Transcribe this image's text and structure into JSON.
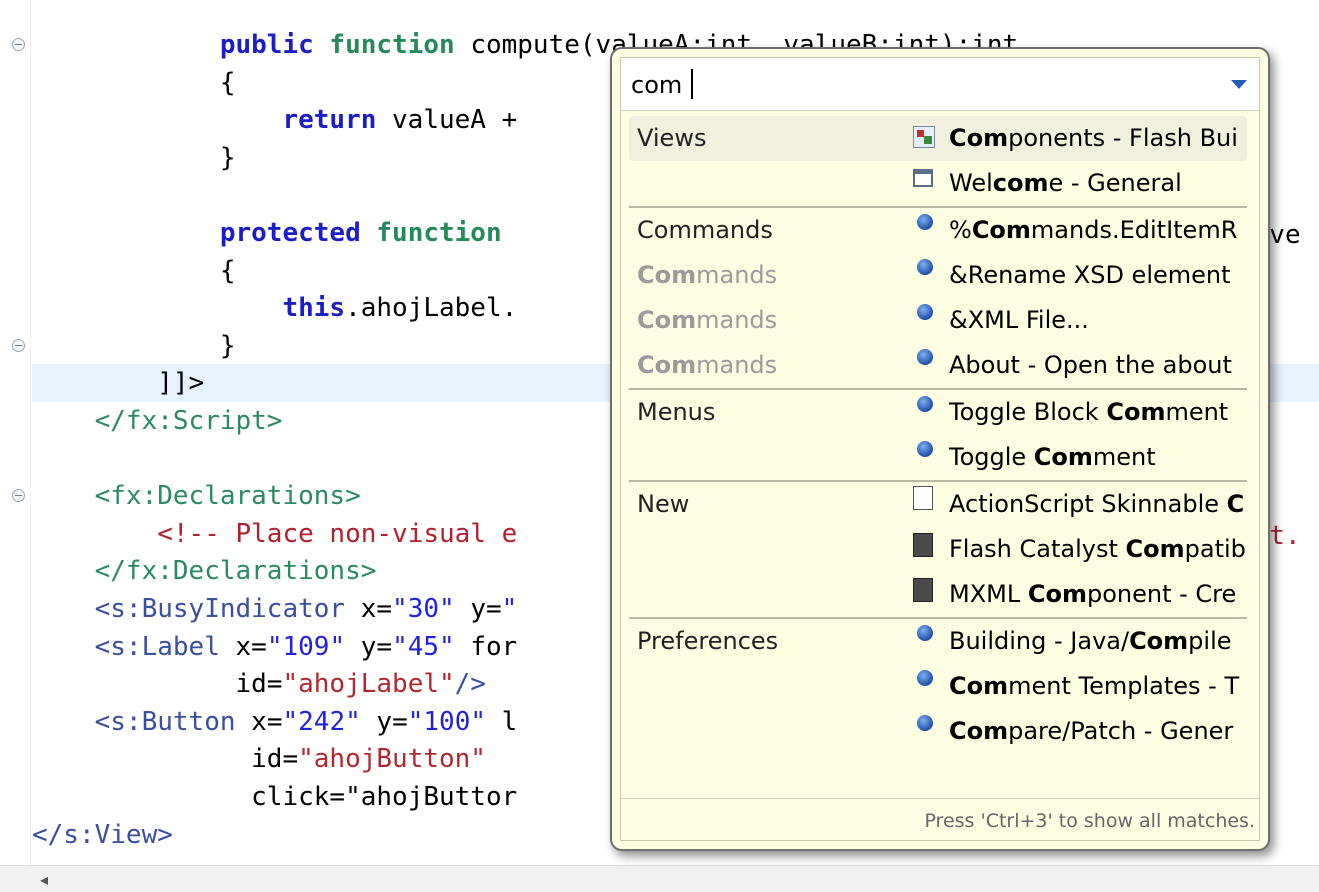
{
  "editor": {
    "lines": [
      {
        "parts": [
          {
            "c": "",
            "t": "            "
          },
          {
            "c": "kw",
            "t": "public "
          },
          {
            "c": "kwg",
            "t": "function "
          },
          {
            "c": "",
            "t": "compute(valueA:int, valueB:int):int"
          }
        ]
      },
      {
        "parts": [
          {
            "c": "",
            "t": "            {"
          }
        ]
      },
      {
        "parts": [
          {
            "c": "",
            "t": "                "
          },
          {
            "c": "kw",
            "t": "return "
          },
          {
            "c": "",
            "t": "valueA + "
          }
        ]
      },
      {
        "parts": [
          {
            "c": "",
            "t": "            }"
          }
        ]
      },
      {
        "parts": [
          {
            "c": "",
            "t": ""
          }
        ]
      },
      {
        "parts": [
          {
            "c": "",
            "t": "            "
          },
          {
            "c": "kw",
            "t": "protected "
          },
          {
            "c": "kwg",
            "t": "function "
          }
        ]
      },
      {
        "parts": [
          {
            "c": "",
            "t": "            {"
          }
        ]
      },
      {
        "parts": [
          {
            "c": "",
            "t": "                "
          },
          {
            "c": "kw",
            "t": "this"
          },
          {
            "c": "",
            "t": ".ahojLabel."
          }
        ]
      },
      {
        "parts": [
          {
            "c": "",
            "t": "            }"
          }
        ]
      },
      {
        "parts": [
          {
            "c": "",
            "t": "        ]]>"
          }
        ],
        "highlight": true
      },
      {
        "parts": [
          {
            "c": "",
            "t": "    "
          },
          {
            "c": "tag",
            "t": "</fx:Script>"
          }
        ]
      },
      {
        "parts": [
          {
            "c": "",
            "t": ""
          }
        ]
      },
      {
        "parts": [
          {
            "c": "",
            "t": "    "
          },
          {
            "c": "tag",
            "t": "<fx:Declarations>"
          }
        ]
      },
      {
        "parts": [
          {
            "c": "",
            "t": "        "
          },
          {
            "c": "comment",
            "t": "<!-- Place non-visual e"
          }
        ]
      },
      {
        "parts": [
          {
            "c": "",
            "t": "    "
          },
          {
            "c": "tag",
            "t": "</fx:Declarations>"
          }
        ]
      },
      {
        "parts": [
          {
            "c": "",
            "t": "    "
          },
          {
            "c": "tagb",
            "t": "<s:BusyIndicator"
          },
          {
            "c": "attr",
            "t": " x="
          },
          {
            "c": "val",
            "t": "\"30\""
          },
          {
            "c": "attr",
            "t": " y="
          },
          {
            "c": "val",
            "t": "\""
          }
        ]
      },
      {
        "parts": [
          {
            "c": "",
            "t": "    "
          },
          {
            "c": "tagb",
            "t": "<s:Label"
          },
          {
            "c": "attr",
            "t": " x="
          },
          {
            "c": "val",
            "t": "\"109\""
          },
          {
            "c": "attr",
            "t": " y="
          },
          {
            "c": "val",
            "t": "\"45\""
          },
          {
            "c": "attr",
            "t": " for"
          }
        ]
      },
      {
        "parts": [
          {
            "c": "",
            "t": "             "
          },
          {
            "c": "attr",
            "t": "id="
          },
          {
            "c": "valr",
            "t": "\"ahojLabel\""
          },
          {
            "c": "tagb",
            "t": "/>"
          }
        ]
      },
      {
        "parts": [
          {
            "c": "",
            "t": "    "
          },
          {
            "c": "tagb",
            "t": "<s:Button"
          },
          {
            "c": "attr",
            "t": " x="
          },
          {
            "c": "val",
            "t": "\"242\""
          },
          {
            "c": "attr",
            "t": " y="
          },
          {
            "c": "val",
            "t": "\"100\""
          },
          {
            "c": "attr",
            "t": " l"
          }
        ]
      },
      {
        "parts": [
          {
            "c": "",
            "t": "              "
          },
          {
            "c": "attr",
            "t": "id="
          },
          {
            "c": "valr",
            "t": "\"ahojButton\""
          }
        ]
      },
      {
        "parts": [
          {
            "c": "",
            "t": "              "
          },
          {
            "c": "attr",
            "t": "click=\"ahojButtor"
          }
        ]
      },
      {
        "parts": [
          {
            "c": "tagb",
            "t": "</s:View>"
          }
        ]
      }
    ],
    "overflow_right": {
      "line_6": "eEve",
      "line_13": "ect."
    }
  },
  "quick_access": {
    "filter_value": "com",
    "results": [
      {
        "category": "Views",
        "category_dim": false,
        "icon": "components-view-icon",
        "icon_type": "comp",
        "label_pre": "",
        "label_bold": "Com",
        "label_post": "ponents - Flash Bui",
        "selected": true,
        "separator": false
      },
      {
        "category": "",
        "category_dim": false,
        "icon": "window-icon",
        "icon_type": "win",
        "label_pre": "Wel",
        "label_bold": "com",
        "label_post": "e - General",
        "selected": false,
        "separator": false
      },
      {
        "category": "Commands",
        "category_dim": false,
        "icon": "command-icon",
        "icon_type": "dot",
        "label_pre": "%",
        "label_bold": "Com",
        "label_post": "mands.EditItemR",
        "selected": false,
        "separator": true
      },
      {
        "category": "Commands",
        "category_dim": true,
        "icon": "command-icon",
        "icon_type": "dot",
        "label_pre": "&Rename XSD element",
        "label_bold": "",
        "label_post": "",
        "selected": false,
        "separator": false
      },
      {
        "category": "Commands",
        "category_dim": true,
        "icon": "command-icon",
        "icon_type": "dot",
        "label_pre": "&XML File...",
        "label_bold": "",
        "label_post": "",
        "selected": false,
        "separator": false
      },
      {
        "category": "Commands",
        "category_dim": true,
        "icon": "command-icon",
        "icon_type": "dot",
        "label_pre": "About - Open the about",
        "label_bold": "",
        "label_post": "",
        "selected": false,
        "separator": false
      },
      {
        "category": "Menus",
        "category_dim": false,
        "icon": "menu-icon",
        "icon_type": "dot",
        "label_pre": "Toggle Block ",
        "label_bold": "Com",
        "label_post": "ment",
        "selected": false,
        "separator": true
      },
      {
        "category": "",
        "category_dim": false,
        "icon": "menu-icon",
        "icon_type": "dot",
        "label_pre": "Toggle ",
        "label_bold": "Com",
        "label_post": "ment",
        "selected": false,
        "separator": false
      },
      {
        "category": "New",
        "category_dim": false,
        "icon": "actionscript-file-icon",
        "icon_type": "file",
        "label_pre": "ActionScript Skinnable ",
        "label_bold": "C",
        "label_post": "",
        "selected": false,
        "separator": true
      },
      {
        "category": "",
        "category_dim": false,
        "icon": "flash-catalyst-icon",
        "icon_type": "fc",
        "label_pre": "Flash Catalyst ",
        "label_bold": "Com",
        "label_post": "patib",
        "selected": false,
        "separator": false
      },
      {
        "category": "",
        "category_dim": false,
        "icon": "mxml-file-icon",
        "icon_type": "fc",
        "label_pre": "MXML ",
        "label_bold": "Com",
        "label_post": "ponent - Cre",
        "selected": false,
        "separator": false
      },
      {
        "category": "Preferences",
        "category_dim": false,
        "icon": "preference-icon",
        "icon_type": "dot",
        "label_pre": "Building - Java/",
        "label_bold": "Com",
        "label_post": "pile",
        "selected": false,
        "separator": true
      },
      {
        "category": "",
        "category_dim": false,
        "icon": "preference-icon",
        "icon_type": "dot",
        "label_pre": "",
        "label_bold": "Com",
        "label_post": "ment Templates - T",
        "selected": false,
        "separator": false
      },
      {
        "category": "",
        "category_dim": false,
        "icon": "preference-icon",
        "icon_type": "dot",
        "label_pre": "",
        "label_bold": "Com",
        "label_post": "pare/Patch - Gener",
        "selected": false,
        "separator": false
      }
    ],
    "footer_hint": "Press 'Ctrl+3' to show all matches.",
    "dim_category_bold": "Com",
    "dim_category_rest": "mands"
  },
  "scrollbar": {
    "left_arrow": "◂"
  }
}
